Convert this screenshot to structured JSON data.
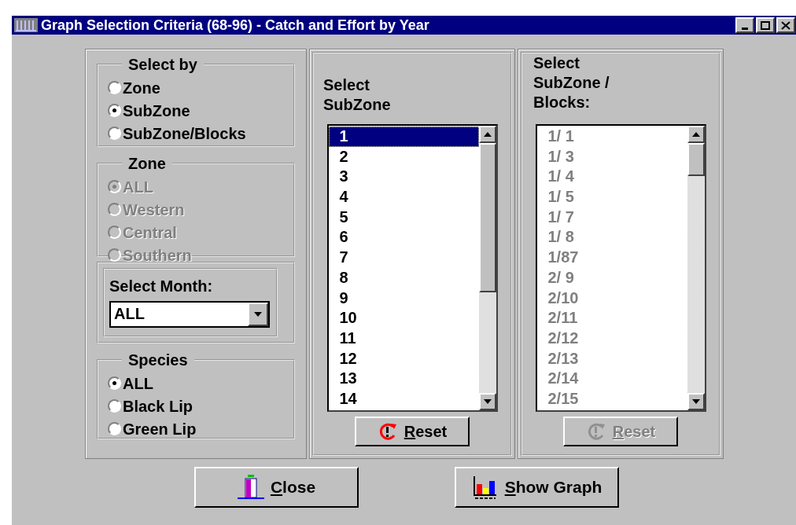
{
  "window": {
    "title": "Graph Selection Criteria (68-96) - Catch and Effort by Year"
  },
  "select_by": {
    "legend": "Select by",
    "disabled": false,
    "options": [
      {
        "label": "Zone",
        "selected": false
      },
      {
        "label": "SubZone",
        "selected": true
      },
      {
        "label": "SubZone/Blocks",
        "selected": false
      }
    ]
  },
  "zone": {
    "legend": "Zone",
    "disabled": true,
    "options": [
      {
        "label": "ALL",
        "selected": true
      },
      {
        "label": "Western",
        "selected": false
      },
      {
        "label": "Central",
        "selected": false
      },
      {
        "label": "Southern",
        "selected": false
      }
    ]
  },
  "month": {
    "label": "Select Month:",
    "value": "ALL"
  },
  "species": {
    "legend": "Species",
    "disabled": false,
    "options": [
      {
        "label": "ALL",
        "selected": true
      },
      {
        "label": "Black Lip",
        "selected": false
      },
      {
        "label": "Green Lip",
        "selected": false
      }
    ]
  },
  "subzone_list": {
    "label": "Select SubZone",
    "disabled": false,
    "reset": {
      "label": "Reset",
      "disabled": false
    },
    "items": [
      {
        "label": "1",
        "selected": true
      },
      {
        "label": "2",
        "selected": false
      },
      {
        "label": "3",
        "selected": false
      },
      {
        "label": "4",
        "selected": false
      },
      {
        "label": "5",
        "selected": false
      },
      {
        "label": "6",
        "selected": false
      },
      {
        "label": "7",
        "selected": false
      },
      {
        "label": "8",
        "selected": false
      },
      {
        "label": "9",
        "selected": false
      },
      {
        "label": "10",
        "selected": false
      },
      {
        "label": "11",
        "selected": false
      },
      {
        "label": "12",
        "selected": false
      },
      {
        "label": "13",
        "selected": false
      },
      {
        "label": "14",
        "selected": false
      }
    ]
  },
  "blocks_list": {
    "label": "Select SubZone / Blocks:",
    "disabled": true,
    "reset": {
      "label": "Reset",
      "disabled": true
    },
    "items": [
      {
        "label": "1/ 1",
        "selected": false
      },
      {
        "label": "1/ 3",
        "selected": false
      },
      {
        "label": "1/ 4",
        "selected": false
      },
      {
        "label": "1/ 5",
        "selected": false
      },
      {
        "label": "1/ 7",
        "selected": false
      },
      {
        "label": "1/ 8",
        "selected": false
      },
      {
        "label": "1/87",
        "selected": false
      },
      {
        "label": "2/ 9",
        "selected": false
      },
      {
        "label": "2/10",
        "selected": false
      },
      {
        "label": "2/11",
        "selected": false
      },
      {
        "label": "2/12",
        "selected": false
      },
      {
        "label": "2/13",
        "selected": false
      },
      {
        "label": "2/14",
        "selected": false
      },
      {
        "label": "2/15",
        "selected": false
      }
    ]
  },
  "buttons": [
    {
      "label": "Close",
      "kind": "close"
    },
    {
      "label": "Show Graph",
      "kind": "graph"
    }
  ]
}
